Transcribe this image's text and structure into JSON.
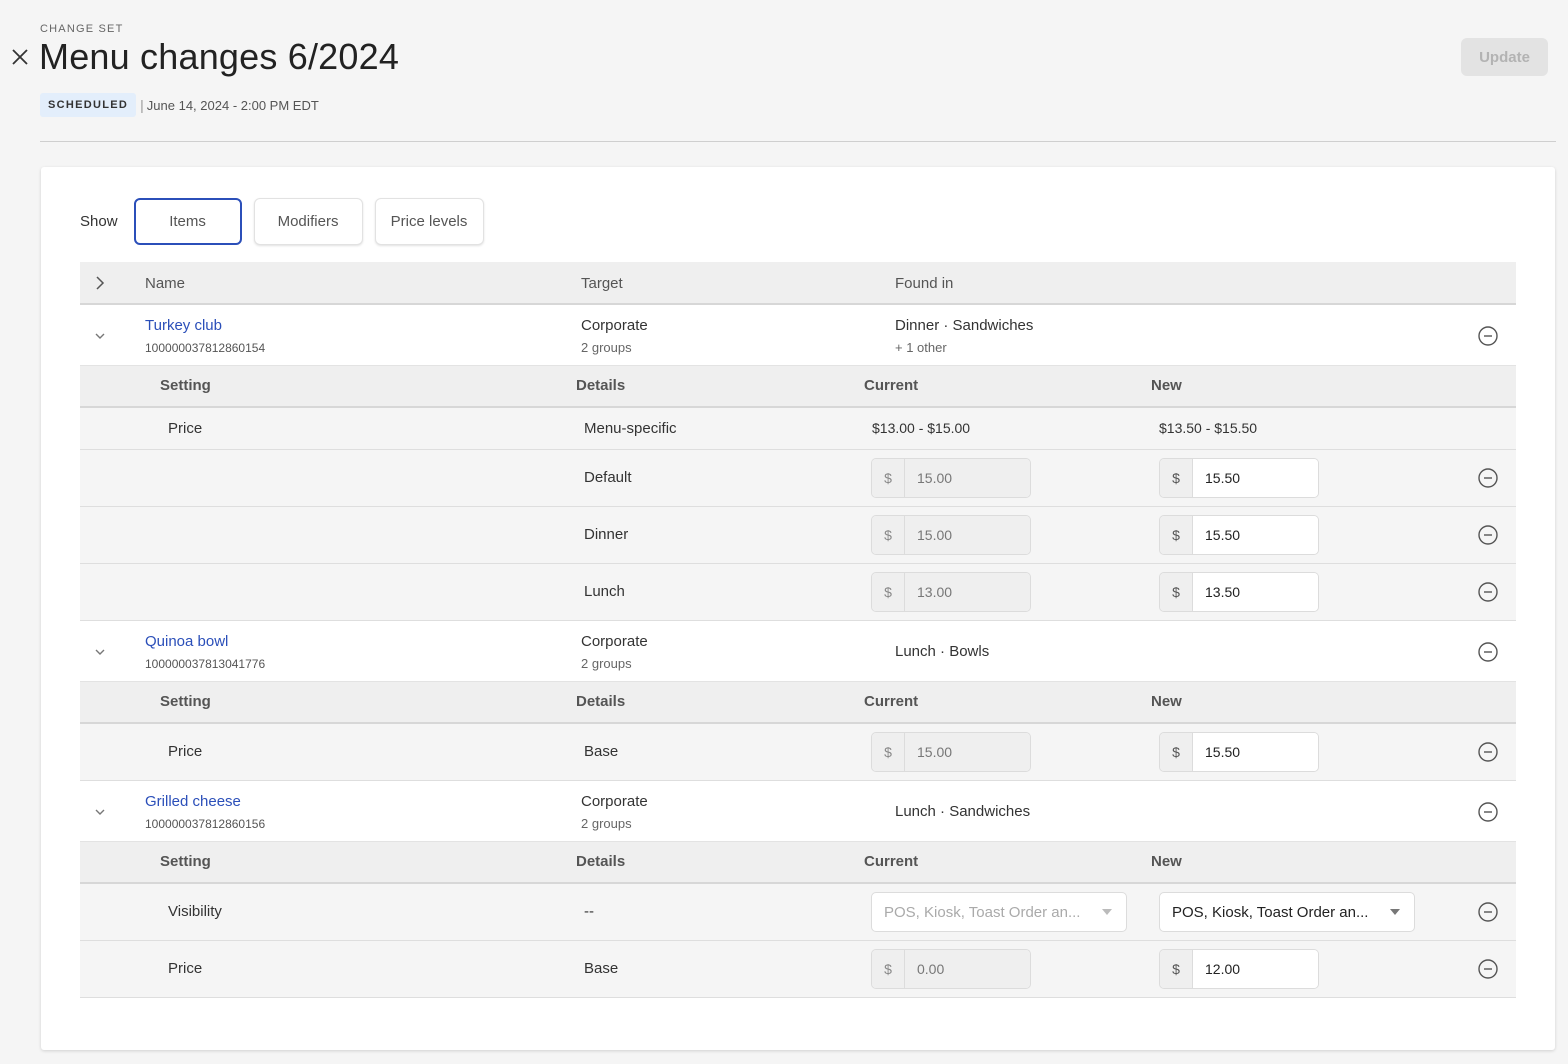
{
  "header": {
    "eyebrow": "CHANGE SET",
    "title": "Menu changes 6/2024",
    "status_badge": "SCHEDULED",
    "separator": "|",
    "scheduled_date": "June 14, 2024 - 2:00 PM EDT",
    "update_label": "Update"
  },
  "filters": {
    "label": "Show",
    "options": [
      "Items",
      "Modifiers",
      "Price levels"
    ],
    "selected": "Items"
  },
  "table": {
    "columns": [
      "Name",
      "Target",
      "Found in"
    ],
    "sub_columns": [
      "Setting",
      "Details",
      "Current",
      "New"
    ],
    "currency_symbol": "$",
    "items": [
      {
        "name": "Turkey club",
        "id": "100000037812860154",
        "target": "Corporate",
        "target_sub": "2 groups",
        "found_in": "Dinner · Sandwiches",
        "found_in_sub": "+ 1 other",
        "settings": [
          {
            "setting": "Price",
            "details": "Menu-specific",
            "current": "$13.00 - $15.00",
            "new": "$13.50 - $15.50"
          },
          {
            "setting": "",
            "details": "Default",
            "current": "15.00",
            "new": "15.50"
          },
          {
            "setting": "",
            "details": "Dinner",
            "current": "15.00",
            "new": "15.50"
          },
          {
            "setting": "",
            "details": "Lunch",
            "current": "13.00",
            "new": "13.50"
          }
        ]
      },
      {
        "name": "Quinoa bowl",
        "id": "100000037813041776",
        "target": "Corporate",
        "target_sub": "2 groups",
        "found_in": "Lunch · Bowls",
        "settings": [
          {
            "setting": "Price",
            "details": "Base",
            "current": "15.00",
            "new": "15.50"
          }
        ]
      },
      {
        "name": "Grilled cheese",
        "id": "100000037812860156",
        "target": "Corporate",
        "target_sub": "2 groups",
        "found_in": "Lunch · Sandwiches",
        "settings": [
          {
            "setting": "Visibility",
            "details": "--",
            "current": "POS, Kiosk, Toast Order an...",
            "new": "POS, Kiosk, Toast Order an..."
          },
          {
            "setting": "Price",
            "details": "Base",
            "current": "0.00",
            "new": "12.00"
          }
        ]
      }
    ]
  }
}
